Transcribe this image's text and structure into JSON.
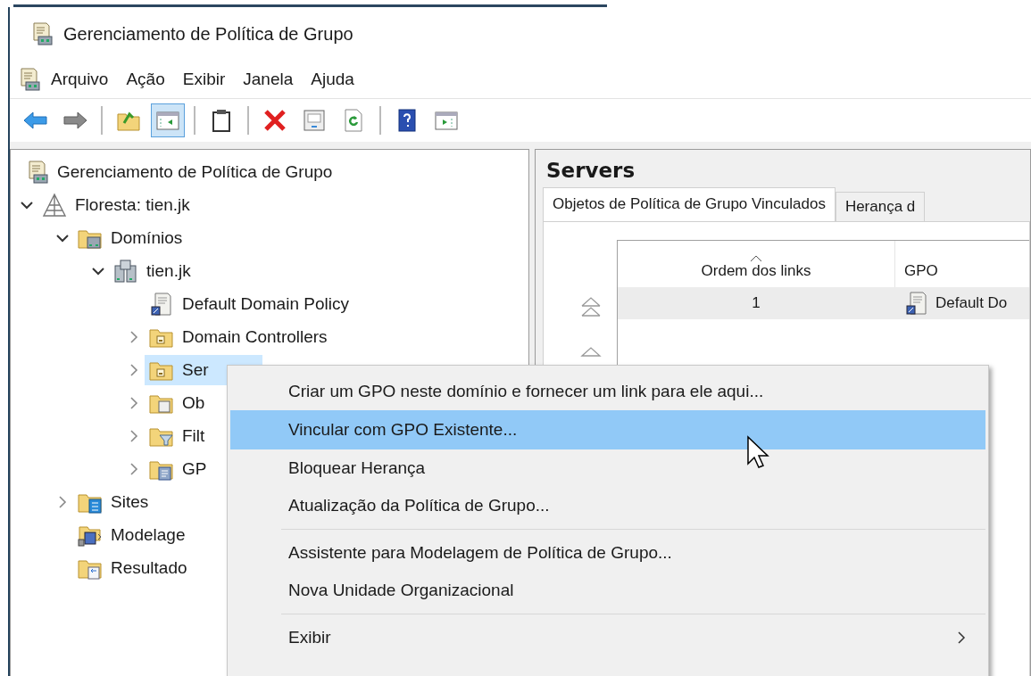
{
  "window": {
    "title": "Gerenciamento de Política de Grupo"
  },
  "menu_bar": [
    "Arquivo",
    "Ação",
    "Exibir",
    "Janela",
    "Ajuda"
  ],
  "toolbar": [
    {
      "kind": "back",
      "pressed": false
    },
    {
      "kind": "forward",
      "pressed": false
    },
    {
      "kind": "separator"
    },
    {
      "kind": "up-folder",
      "pressed": false
    },
    {
      "kind": "console-tree",
      "pressed": true
    },
    {
      "kind": "separator"
    },
    {
      "kind": "clipboard",
      "pressed": false
    },
    {
      "kind": "separator"
    },
    {
      "kind": "delete",
      "pressed": false
    },
    {
      "kind": "properties",
      "pressed": false
    },
    {
      "kind": "refresh",
      "pressed": false
    },
    {
      "kind": "separator"
    },
    {
      "kind": "help",
      "pressed": false
    },
    {
      "kind": "action-pane",
      "pressed": false
    }
  ],
  "tree": [
    {
      "label": "Gerenciamento de Política de Grupo",
      "kind": "gpm",
      "selected": false,
      "children": [
        {
          "label": "Floresta: tien.jk",
          "kind": "forest",
          "expanded": true,
          "selected": false,
          "children": [
            {
              "label": "Domínios",
              "kind": "domains",
              "expanded": true,
              "selected": false,
              "children": [
                {
                  "label": "tien.jk",
                  "kind": "domain",
                  "expanded": true,
                  "selected": false,
                  "children": [
                    {
                      "label": "Default Domain Policy",
                      "kind": "gpo",
                      "selected": false
                    },
                    {
                      "label": "Domain Controllers",
                      "kind": "ou",
                      "expanded": false,
                      "selected": false
                    },
                    {
                      "label": "Ser",
                      "kind": "ou",
                      "expanded": false,
                      "selected": true
                    },
                    {
                      "label": "Ob",
                      "kind": "wmi-folder",
                      "expanded": false,
                      "selected": false
                    },
                    {
                      "label": "Filt",
                      "kind": "filter",
                      "expanded": false,
                      "selected": false
                    },
                    {
                      "label": "GP",
                      "kind": "gpo-folder",
                      "expanded": false,
                      "selected": false
                    }
                  ]
                }
              ]
            },
            {
              "label": "Sites",
              "kind": "sites",
              "expanded": false,
              "selected": false
            },
            {
              "label": "Modelage",
              "kind": "modeling",
              "selected": false
            },
            {
              "label": "Resultado",
              "kind": "results",
              "selected": false
            }
          ]
        }
      ]
    }
  ],
  "details": {
    "title": "Servers",
    "tabs": [
      {
        "label": "Objetos de Política de Grupo Vinculados",
        "selected": true
      },
      {
        "label": "Herança d",
        "selected": false
      }
    ],
    "table": {
      "columns": [
        {
          "label": "Ordem dos links",
          "sorted": true
        },
        {
          "label": "GPO",
          "sorted": false
        }
      ],
      "rows": [
        {
          "cells": [
            "1",
            "Default Do"
          ],
          "selected": true
        }
      ]
    }
  },
  "context_menu": [
    {
      "kind": "item",
      "label": "Criar um GPO neste domínio e fornecer um link para ele aqui...",
      "selected": false,
      "submenu": false
    },
    {
      "kind": "item",
      "label": "Vincular com GPO Existente...",
      "selected": true,
      "submenu": false
    },
    {
      "kind": "item",
      "label": "Bloquear Herança",
      "selected": false,
      "submenu": false
    },
    {
      "kind": "item",
      "label": "Atualização da Política de Grupo...",
      "selected": false,
      "submenu": false
    },
    {
      "kind": "separator"
    },
    {
      "kind": "item",
      "label": "Assistente para Modelagem de Política de Grupo...",
      "selected": false,
      "submenu": false
    },
    {
      "kind": "item",
      "label": "Nova Unidade Organizacional",
      "selected": false,
      "submenu": false
    },
    {
      "kind": "separator"
    },
    {
      "kind": "item",
      "label": "Exibir",
      "selected": false,
      "submenu": true
    }
  ]
}
